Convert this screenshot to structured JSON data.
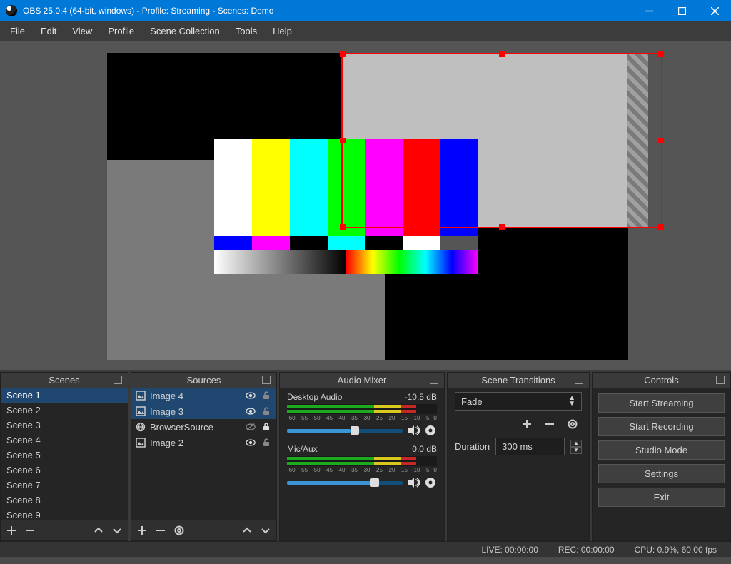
{
  "titlebar": {
    "title": "OBS 25.0.4 (64-bit, windows) - Profile: Streaming - Scenes: Demo"
  },
  "menu": [
    {
      "label": "File"
    },
    {
      "label": "Edit"
    },
    {
      "label": "View"
    },
    {
      "label": "Profile"
    },
    {
      "label": "Scene Collection"
    },
    {
      "label": "Tools"
    },
    {
      "label": "Help"
    }
  ],
  "panels": {
    "scenes": {
      "title": "Scenes"
    },
    "sources": {
      "title": "Sources"
    },
    "mixer": {
      "title": "Audio Mixer"
    },
    "transitions": {
      "title": "Scene Transitions"
    },
    "controls": {
      "title": "Controls"
    }
  },
  "scenes": [
    {
      "label": "Scene 1",
      "selected": true
    },
    {
      "label": "Scene 2"
    },
    {
      "label": "Scene 3"
    },
    {
      "label": "Scene 4"
    },
    {
      "label": "Scene 5"
    },
    {
      "label": "Scene 6"
    },
    {
      "label": "Scene 7"
    },
    {
      "label": "Scene 8"
    },
    {
      "label": "Scene 9"
    }
  ],
  "sources": [
    {
      "label": "Image 4",
      "icon": "image",
      "visible": true,
      "locked": false,
      "selected": true
    },
    {
      "label": "Image 3",
      "icon": "image",
      "visible": true,
      "locked": false,
      "selected": true
    },
    {
      "label": "BrowserSource",
      "icon": "globe",
      "visible": false,
      "locked": true,
      "selected": false
    },
    {
      "label": "Image 2",
      "icon": "image",
      "visible": true,
      "locked": false,
      "selected": false
    }
  ],
  "mixer": {
    "channels": [
      {
        "name": "Desktop Audio",
        "db": "-10.5 dB",
        "slider": 55
      },
      {
        "name": "Mic/Aux",
        "db": "0.0 dB",
        "slider": 72
      }
    ],
    "ticks": [
      "-60",
      "-55",
      "-50",
      "-45",
      "-40",
      "-35",
      "-30",
      "-25",
      "-20",
      "-15",
      "-10",
      "-5",
      "0"
    ]
  },
  "transitions": {
    "selected": "Fade",
    "duration_label": "Duration",
    "duration_value": "300 ms"
  },
  "controls": {
    "buttons": [
      {
        "label": "Start Streaming"
      },
      {
        "label": "Start Recording"
      },
      {
        "label": "Studio Mode"
      },
      {
        "label": "Settings"
      },
      {
        "label": "Exit"
      }
    ]
  },
  "status": {
    "live": "LIVE: 00:00:00",
    "rec": "REC: 00:00:00",
    "cpu": "CPU: 0.9%, 60.00 fps"
  }
}
